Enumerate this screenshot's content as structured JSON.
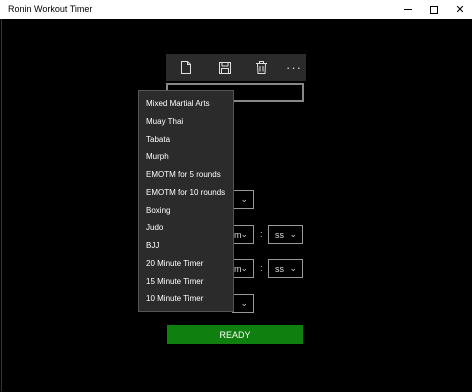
{
  "window": {
    "title": "Ronin Workout Timer",
    "minimize_glyph": "",
    "maximize_glyph": "",
    "close_glyph": "✕"
  },
  "commandbar": {
    "more_glyph": "···",
    "icons": [
      "new-document-icon",
      "save-icon",
      "delete-icon",
      "more-icon"
    ]
  },
  "workout_name": {
    "value": ""
  },
  "fields": {
    "rounds": {
      "value": ""
    },
    "work_minutes": {
      "value": "m"
    },
    "work_seconds": {
      "value": "ss"
    },
    "rest_minutes": {
      "value": "m"
    },
    "rest_seconds": {
      "value": "ss"
    },
    "warning": {
      "value": ""
    },
    "time_separator": ":"
  },
  "ready_button": {
    "label": "READY"
  },
  "preset_menu": {
    "items": [
      {
        "label": "Mixed Martial Arts"
      },
      {
        "label": "Muay Thai"
      },
      {
        "label": "Tabata"
      },
      {
        "label": "Murph"
      },
      {
        "label": "EMOTM for 5 rounds"
      },
      {
        "label": "EMOTM for 10 rounds"
      },
      {
        "label": "Boxing"
      },
      {
        "label": "Judo"
      },
      {
        "label": "BJJ"
      },
      {
        "label": "20 Minute Timer"
      },
      {
        "label": "15 Minute Timer"
      },
      {
        "label": "10 Minute Timer"
      }
    ]
  },
  "colors": {
    "background": "#000000",
    "titlebar": "#ffffff",
    "commandbar": "#2b2b2b",
    "menu": "#2b2b2b",
    "ready": "#0f7f0f"
  }
}
